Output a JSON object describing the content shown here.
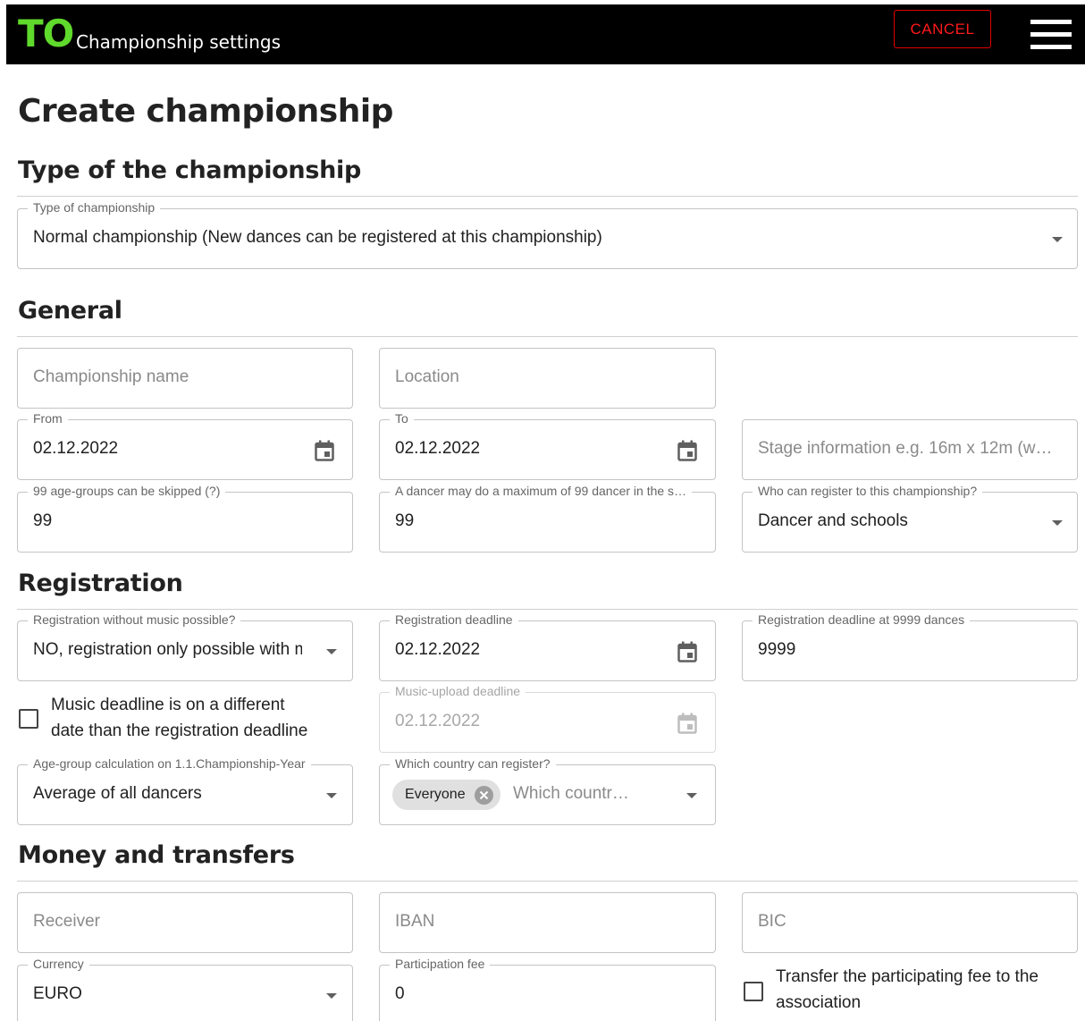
{
  "appbar": {
    "logo": "TO",
    "title": "Championship settings",
    "cancel_label": "CANCEL"
  },
  "page": {
    "title": "Create championship"
  },
  "sections": {
    "type": "Type of the championship",
    "general": "General",
    "registration": "Registration",
    "money": "Money and transfers"
  },
  "type_of_championship": {
    "label": "Type of championship",
    "value": "Normal championship (New dances can be registered at this championship)"
  },
  "general": {
    "name_placeholder": "Championship name",
    "location_placeholder": "Location",
    "from_label": "From",
    "from_value": "02.12.2022",
    "to_label": "To",
    "to_value": "02.12.2022",
    "stage_placeholder": "Stage information e.g. 16m x 12m (w…",
    "skip_label": "99 age-groups can be skipped (?)",
    "skip_value": "99",
    "max_label": "A dancer may do a maximum of 99 dancer in the s…",
    "max_value": "99",
    "who_label": "Who can register to this championship?",
    "who_value": "Dancer and schools"
  },
  "registration": {
    "without_music_label": "Registration without music possible?",
    "without_music_value": "NO, registration only possible with m",
    "deadline_label": "Registration deadline",
    "deadline_value": "02.12.2022",
    "deadline_at_label": "Registration deadline at 9999 dances",
    "deadline_at_value": "9999",
    "music_checkbox_line1": "Music deadline is on a different",
    "music_checkbox_line2": "date than the registration deadline",
    "music_upload_label": "Music-upload deadline",
    "music_upload_value": "02.12.2022",
    "agegroup_label": "Age-group calculation on 1.1.Championship-Year",
    "agegroup_value": "Average of all dancers",
    "country_label": "Which country can register?",
    "country_chip": "Everyone",
    "country_placeholder": "Which countr…"
  },
  "money": {
    "receiver_placeholder": "Receiver",
    "iban_placeholder": "IBAN",
    "bic_placeholder": "BIC",
    "currency_label": "Currency",
    "currency_value": "EURO",
    "fee_label": "Participation fee",
    "fee_value": "0",
    "transfer_line1": "Transfer the participating fee to the",
    "transfer_line2": "association"
  },
  "colors": {
    "logo_accent": "#5fd92b",
    "cancel_border": "#e00000",
    "appbar_bg": "#000000"
  }
}
